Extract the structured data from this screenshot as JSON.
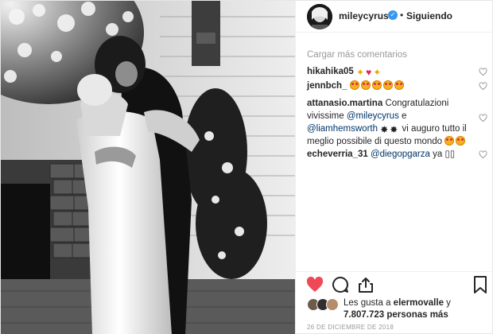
{
  "post": {
    "username": "mileycyrus",
    "verified_symbol": "✓",
    "separator": "•",
    "follow_status": "Siguiendo"
  },
  "comments_section": {
    "load_more": "Cargar más comentarios",
    "comments": [
      {
        "username": "hikahika05",
        "text": "",
        "emojis": [
          "sparkles",
          "red-heart",
          "sparkles"
        ]
      },
      {
        "username": "jennbch_",
        "text": "",
        "emojis": [
          "heart-eyes",
          "heart-eyes",
          "heart-eyes",
          "heart-eyes",
          "heart-eyes"
        ]
      },
      {
        "username": "attanasio.martina",
        "text_1": "Congratulazioni vivissime",
        "mention_1": "@mileycyrus",
        "text_2": "e",
        "mention_2": "@liamhemsworth",
        "text_3": "vi auguro tutto il meglio possibile di questo mondo"
      },
      {
        "username": "echeverria_31",
        "mention": "@diegopgarza",
        "text": "ya",
        "trailing": "▯▯"
      }
    ]
  },
  "actions": {
    "like_icon": "heart-icon",
    "comment_icon": "comment-icon",
    "share_icon": "share-icon",
    "save_icon": "bookmark-icon",
    "like_color": "#ed4956"
  },
  "likes": {
    "prefix": "Les gusta a",
    "user": "elermovalle",
    "joiner": "y",
    "count": "7.807.723",
    "suffix": "personas más"
  },
  "date": "26 DE DICIEMBRE DE 2018"
}
